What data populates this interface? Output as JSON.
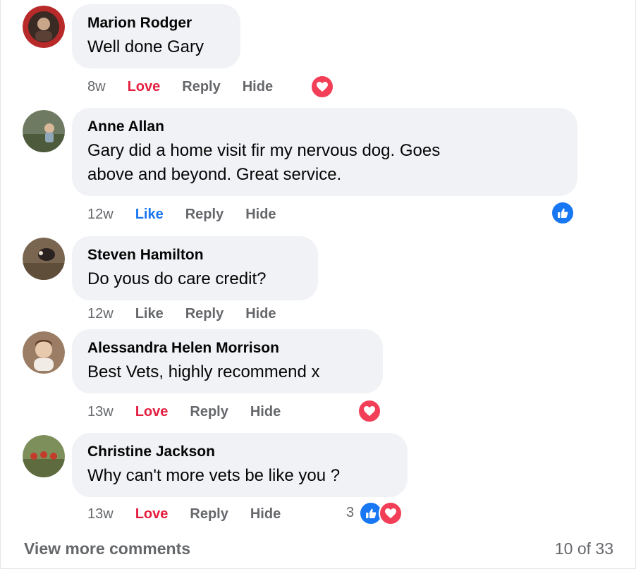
{
  "comments": [
    {
      "author": "Marion Rodger",
      "text": "Well done Gary",
      "time": "8w",
      "react_label": "Love",
      "reply_label": "Reply",
      "hide_label": "Hide",
      "reaction_icons": [
        "love-icon"
      ],
      "reaction_count": ""
    },
    {
      "author": "Anne Allan",
      "text_lines": [
        "Gary did a home visit fir my nervous dog. Goes",
        "above and beyond. Great service."
      ],
      "time": "12w",
      "react_label": "Like",
      "reply_label": "Reply",
      "hide_label": "Hide",
      "reaction_icons": [
        "like-icon"
      ],
      "reaction_count": ""
    },
    {
      "author": "Steven Hamilton",
      "text": "Do yous do care credit?",
      "time": "12w",
      "react_label": "Like",
      "reply_label": "Reply",
      "hide_label": "Hide",
      "reaction_icons": [],
      "reaction_count": ""
    },
    {
      "author": "Alessandra Helen Morrison",
      "text": "Best Vets, highly recommend x",
      "time": "13w",
      "react_label": "Love",
      "reply_label": "Reply",
      "hide_label": "Hide",
      "reaction_icons": [
        "love-icon"
      ],
      "reaction_count": ""
    },
    {
      "author": "Christine Jackson",
      "text": "Why can't more vets be like you ?",
      "time": "13w",
      "react_label": "Love",
      "reply_label": "Reply",
      "hide_label": "Hide",
      "reaction_icons": [
        "like-icon",
        "love-icon"
      ],
      "reaction_count": "3"
    }
  ],
  "footer": {
    "view_more_label": "View more comments",
    "pagination": "10 of 33"
  },
  "colors": {
    "love": "#e41e3f",
    "like": "#1877f2",
    "meta": "#65676b",
    "bubble": "#f0f2f5"
  }
}
